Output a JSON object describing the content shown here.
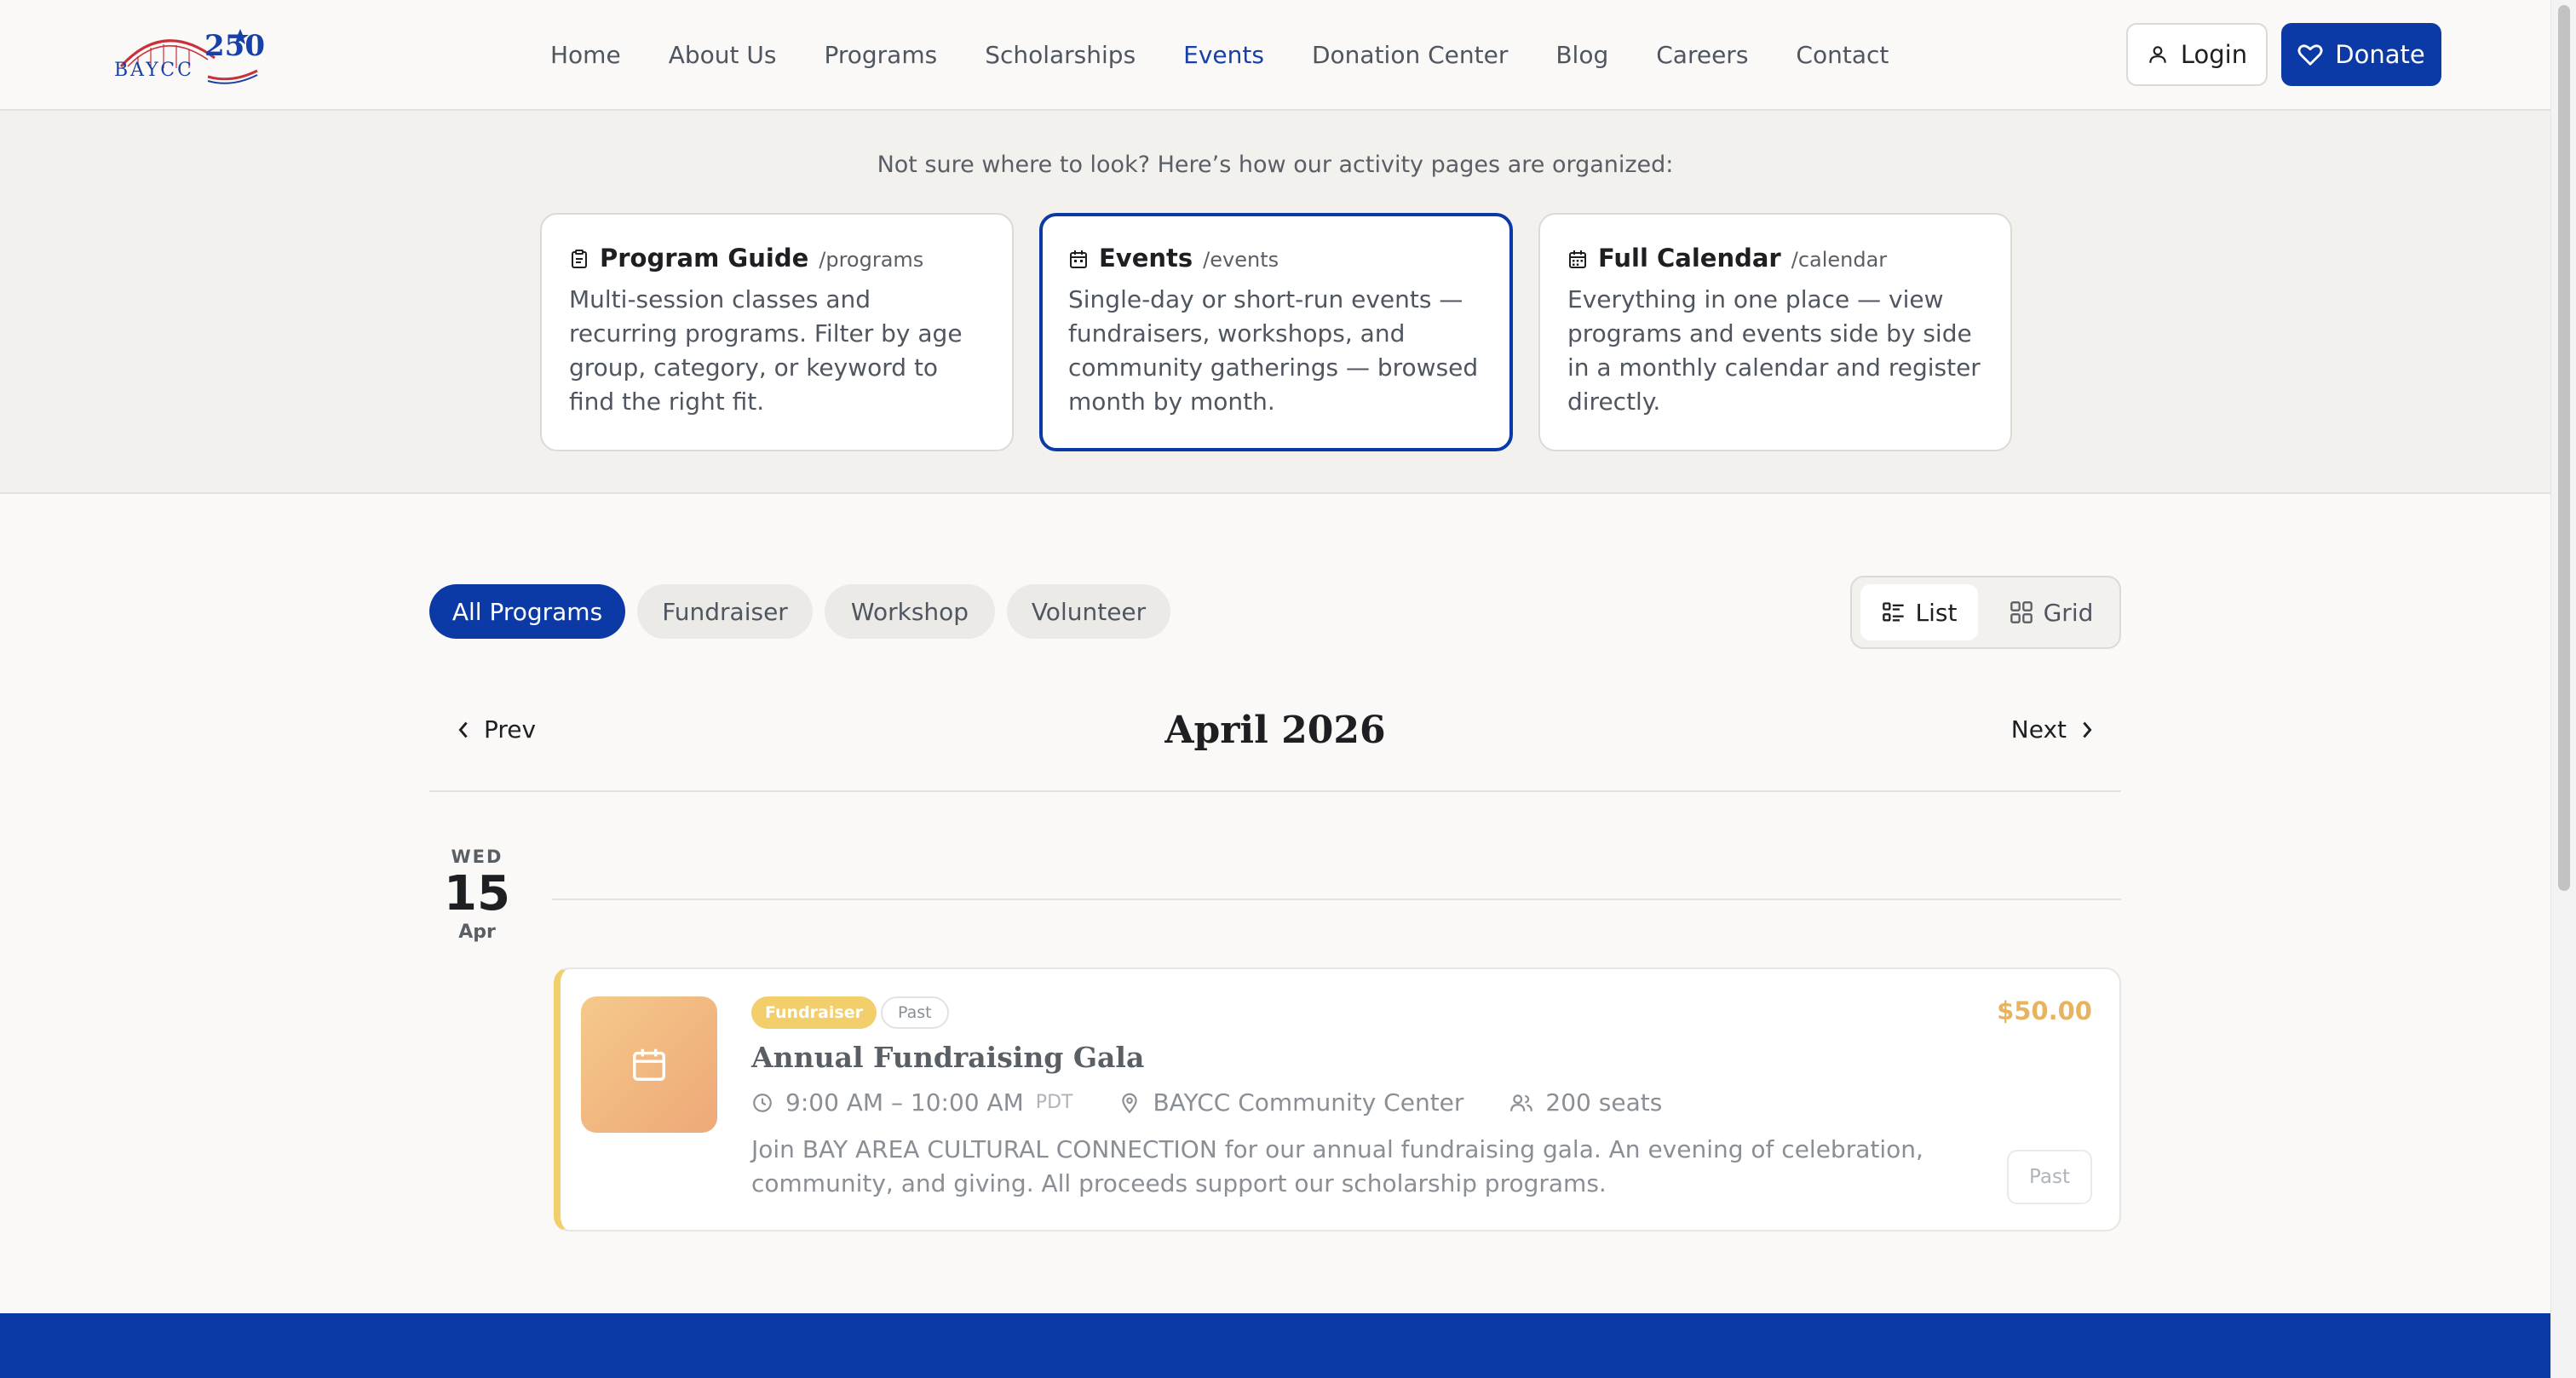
{
  "header": {
    "logo_text": "BAYCC",
    "logo_number": "250",
    "nav": [
      {
        "label": "Home"
      },
      {
        "label": "About Us"
      },
      {
        "label": "Programs"
      },
      {
        "label": "Scholarships"
      },
      {
        "label": "Events",
        "active": true
      },
      {
        "label": "Donation Center"
      },
      {
        "label": "Blog"
      },
      {
        "label": "Careers"
      },
      {
        "label": "Contact"
      }
    ],
    "login_label": "Login",
    "donate_label": "Donate"
  },
  "guide": {
    "intro": "Not sure where to look? Here’s how our activity pages are organized:",
    "cards": [
      {
        "title": "Program Guide",
        "path": "/programs",
        "icon": "clipboard-icon",
        "desc": "Multi-session classes and recurring programs. Filter by age group, category, or keyword to find the right fit."
      },
      {
        "title": "Events",
        "path": "/events",
        "icon": "calendar-icon",
        "active": true,
        "desc": "Single-day or short-run events — fundraisers, workshops, and community gatherings — browsed month by month."
      },
      {
        "title": "Full Calendar",
        "path": "/calendar",
        "icon": "calendar-grid-icon",
        "desc": "Everything in one place — view programs and events side by side in a monthly calendar and register directly."
      }
    ]
  },
  "filters": {
    "chips": [
      "All Programs",
      "Fundraiser",
      "Workshop",
      "Volunteer"
    ],
    "active": "All Programs"
  },
  "view_toggle": {
    "list_label": "List",
    "grid_label": "Grid",
    "active": "List"
  },
  "month_nav": {
    "prev_label": "Prev",
    "next_label": "Next",
    "title": "April 2026"
  },
  "day": {
    "dow": "WED",
    "num": "15",
    "mon": "Apr"
  },
  "event": {
    "type_badge": "Fundraiser",
    "status_badge": "Past",
    "title": "Annual Fundraising Gala",
    "time": "9:00 AM – 10:00 AM",
    "tz": "PDT",
    "location": "BAYCC Community Center",
    "seats": "200 seats",
    "description": "Join BAY AREA CULTURAL CONNECTION for our annual fundraising gala. An evening of celebration, community, and giving. All proceeds support our scholarship programs.",
    "price": "$50.00",
    "action_label": "Past"
  },
  "colors": {
    "primary": "#0b3aa6",
    "accent_yellow": "#f2cf6a",
    "price": "#e8b35f"
  }
}
